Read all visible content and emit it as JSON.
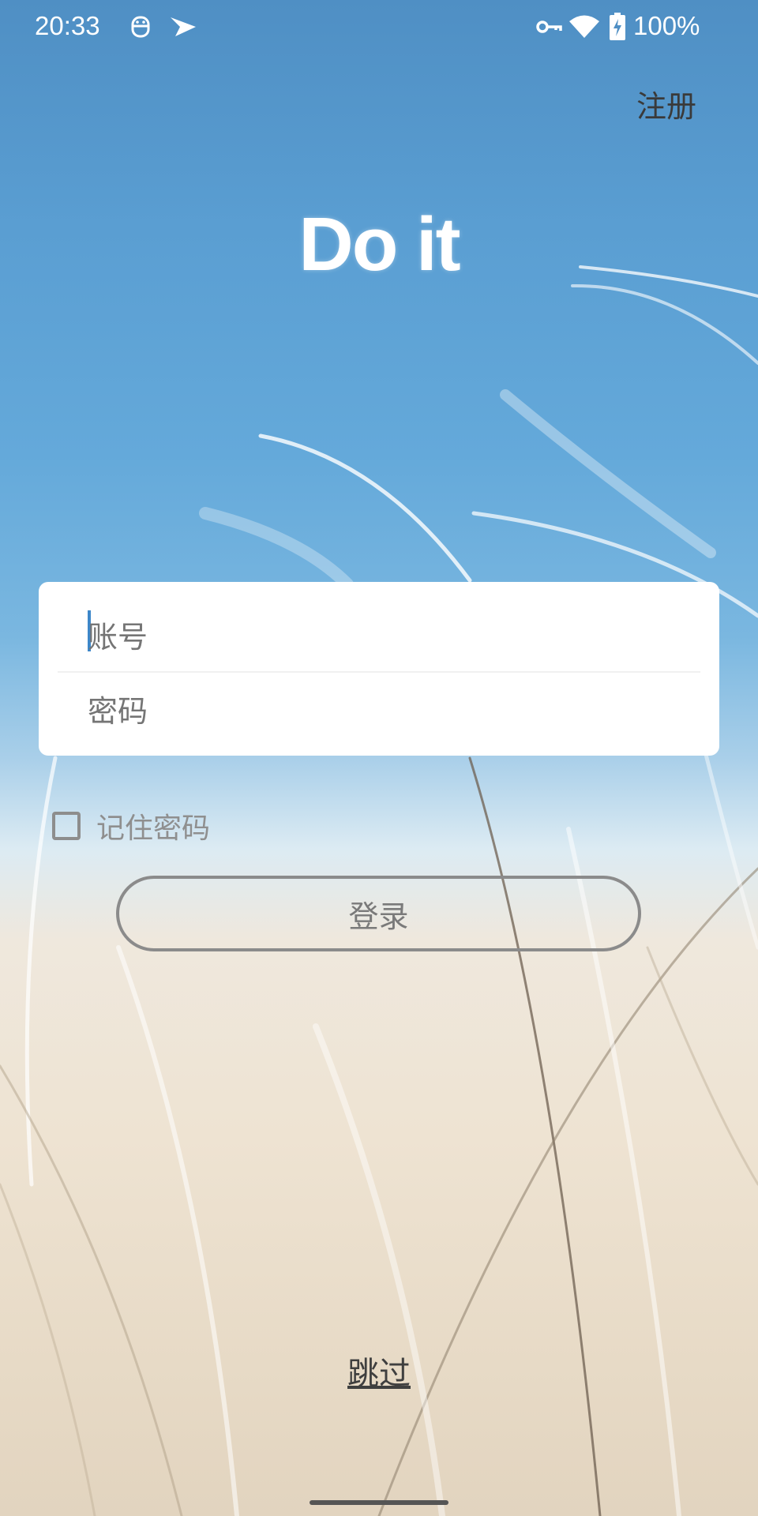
{
  "status_bar": {
    "time": "20:33",
    "battery_text": "100%",
    "icons": [
      "robot-notification-icon",
      "send-notification-icon",
      "vpn-key-icon",
      "wifi-icon",
      "battery-charging-icon"
    ]
  },
  "header": {
    "register_label": "注册"
  },
  "app": {
    "title": "Do it"
  },
  "login_form": {
    "account_placeholder": "账号",
    "password_placeholder": "密码",
    "remember_label": "记住密码",
    "remember_checked": false,
    "login_button_label": "登录"
  },
  "footer": {
    "skip_label": "跳过"
  },
  "colors": {
    "sky_top": "#4f8fc4",
    "grass": "#eee3d2",
    "caret": "#3d87c9",
    "button_border": "#8b8b8b"
  }
}
